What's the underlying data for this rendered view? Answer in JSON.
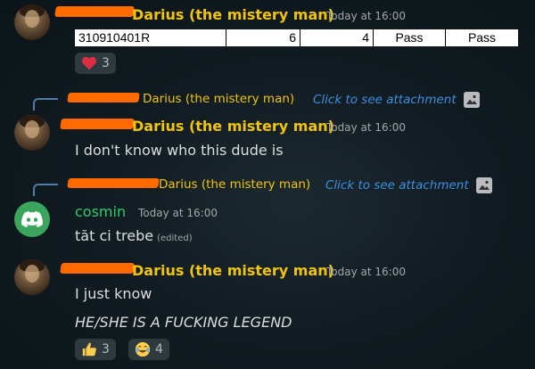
{
  "messages": {
    "m1": {
      "username": "Darius (the mistery man)",
      "timestamp": "Today at 16:00",
      "table_row": [
        "310910401R",
        "6",
        "4",
        "Pass",
        "Pass"
      ],
      "reaction": {
        "emoji": "heart",
        "count": "3"
      }
    },
    "m2": {
      "reply": {
        "username": "Darius (the mistery man)",
        "link": "Click to see attachment"
      },
      "username": "Darius (the mistery man)",
      "timestamp": "Today at 16:00",
      "text": "I don't know who this dude is"
    },
    "m3": {
      "reply": {
        "username": "Darius (the mistery man)",
        "link": "Click to see attachment"
      },
      "username": "cosmin",
      "timestamp": "Today at 16:00",
      "text": "tăt ci trebe",
      "edited": "(edited)"
    },
    "m4": {
      "username": "Darius (the mistery man)",
      "timestamp": "Today at 16:00",
      "line1": "I just know",
      "line2": "HE/SHE IS A FUCKING LEGEND",
      "reactions": [
        {
          "emoji": "thumbs-up",
          "count": "3"
        },
        {
          "emoji": "joy",
          "count": "4"
        }
      ]
    }
  },
  "colors": {
    "username": "#f1c40f",
    "cosmin": "#2ecc71",
    "link": "#3d8ee0",
    "redaction": "#ff6a00"
  }
}
